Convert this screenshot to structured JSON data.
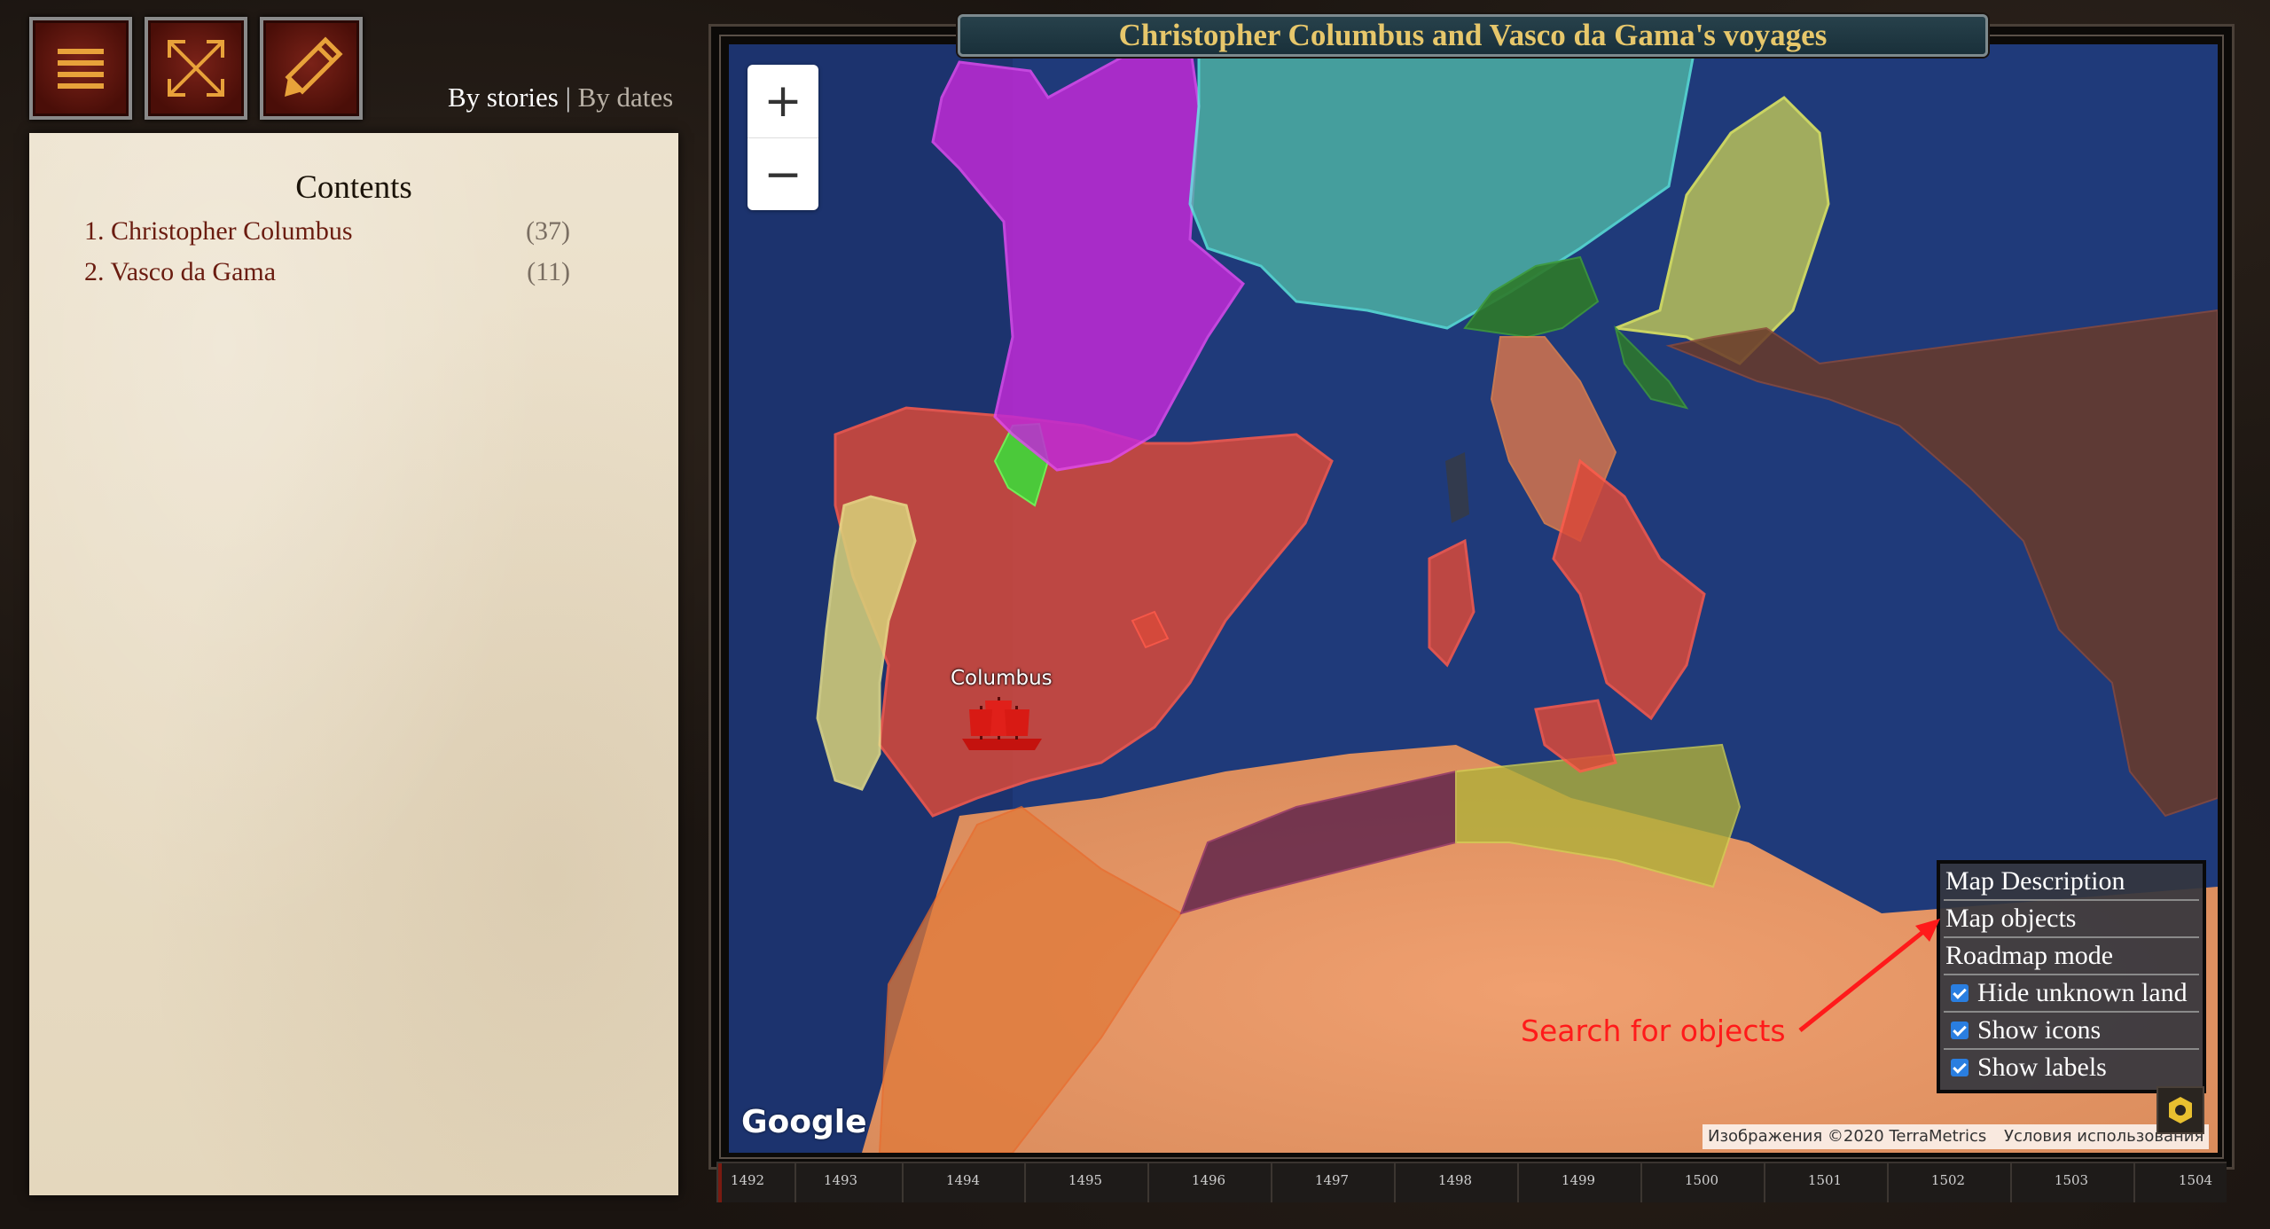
{
  "toolbar": {
    "menu_icon": "hamburger-icon",
    "fullscreen_icon": "expand-arrows-icon",
    "edit_icon": "pencil-icon",
    "view_by_stories": "By stories",
    "separator": "|",
    "view_by_dates": "By dates"
  },
  "contents": {
    "title": "Contents",
    "stories": [
      {
        "label": "1. Christopher Columbus",
        "count": "(37)"
      },
      {
        "label": "2. Vasco da Gama",
        "count": "(11)"
      }
    ]
  },
  "map": {
    "title": "Christopher Columbus and Vasco da Gama's voyages",
    "zoom_in": "+",
    "zoom_out": "−",
    "marker_label": "Columbus",
    "marker_icon": "ship-icon",
    "google_logo": "Google",
    "attribution": "Изображения ©2020 TerraMetrics",
    "terms": "Условия использования",
    "search_hint": "Search for objects",
    "colors": {
      "sea": "#1f3a7a",
      "spain": "#d94a3a",
      "portugal": "#d8d27a",
      "france": "#c02ad6",
      "navarre": "#3fd83a",
      "italy_south": "#d94a3a",
      "italy_papal": "#e0784a",
      "swiss_germany": "#4fb8a6",
      "venice": "#2e7a2a",
      "hungary": "#b8c05a",
      "ottoman": "#6a3a2a",
      "morocco": "#e07a3a",
      "tlemcen": "#5a1f4a",
      "tunis": "#b0b03a",
      "accent_red": "#ff1a1a"
    }
  },
  "map_menu": {
    "items": [
      {
        "label": "Map Description",
        "checkbox": false
      },
      {
        "label": "Map objects",
        "checkbox": false
      },
      {
        "label": "Roadmap mode",
        "checkbox": false
      },
      {
        "label": "Hide unknown land",
        "checkbox": true
      },
      {
        "label": "Show icons",
        "checkbox": true
      },
      {
        "label": "Show labels",
        "checkbox": true
      }
    ],
    "settings_icon": "gear-icon"
  },
  "timeline": {
    "years": [
      "1492",
      "1493",
      "1494",
      "1495",
      "1496",
      "1497",
      "1498",
      "1499",
      "1500",
      "1501",
      "1502",
      "1503",
      "1504"
    ]
  }
}
